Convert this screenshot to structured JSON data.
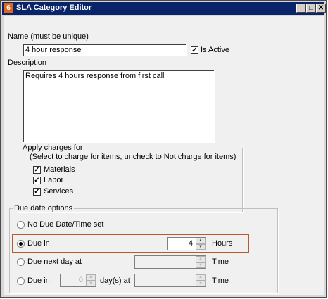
{
  "window": {
    "title": "SLA Category Editor",
    "app_icon_glyph": "6",
    "minimize_glyph": "_",
    "maximize_glyph": "□",
    "close_glyph": "✕"
  },
  "name": {
    "label": "Name (must be unique)",
    "value": "4 hour response",
    "is_active_label": "Is Active",
    "is_active_checked": true
  },
  "description": {
    "label": "Description",
    "value": "Requires 4 hours response from first call"
  },
  "charges": {
    "group_title": "Apply charges for",
    "hint": "(Select to charge for items, uncheck to Not charge for items)",
    "items": [
      {
        "label": "Materials",
        "checked": true
      },
      {
        "label": "Labor",
        "checked": true
      },
      {
        "label": "Services",
        "checked": true
      }
    ]
  },
  "due_date": {
    "group_title": "Due date options",
    "no_due_label": "No Due Date/Time set",
    "due_in_label": "Due in",
    "due_in_value": "4",
    "hours_label": "Hours",
    "due_next_day_label": "Due next day at",
    "time_label": "Time",
    "due_in_days_label": "Due in",
    "days_value": "0",
    "days_at_label": "day(s) at",
    "time_label_2": "Time",
    "selected": "due_in_hours"
  },
  "colors": {
    "titlebar": "#0a246a",
    "highlight": "#b85a2a"
  }
}
